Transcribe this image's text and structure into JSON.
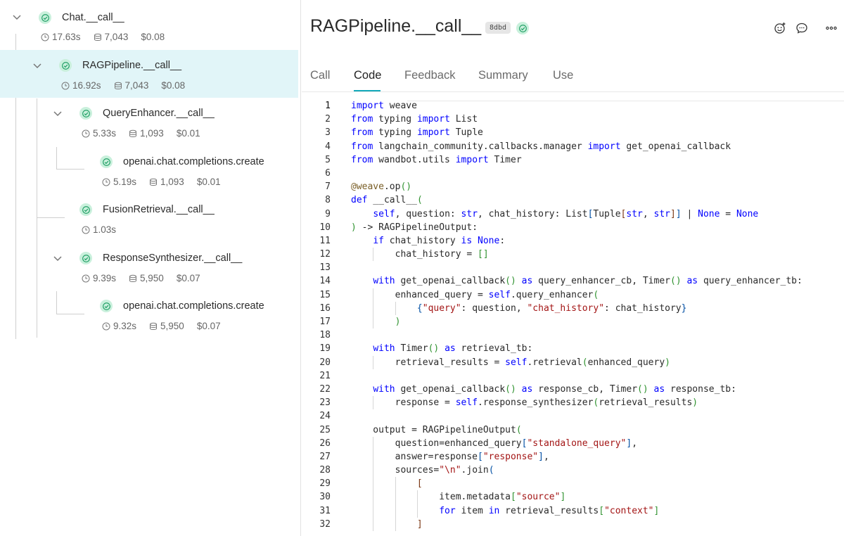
{
  "tree": {
    "nodes": [
      {
        "name": "Chat.__call__",
        "time": "17.63s",
        "tokens": "7,043",
        "cost": "$0.08"
      },
      {
        "name": "RAGPipeline.__call__",
        "time": "16.92s",
        "tokens": "7,043",
        "cost": "$0.08",
        "selected": true
      },
      {
        "name": "QueryEnhancer.__call__",
        "time": "5.33s",
        "tokens": "1,093",
        "cost": "$0.01"
      },
      {
        "name": "openai.chat.completions.create",
        "time": "5.19s",
        "tokens": "1,093",
        "cost": "$0.01"
      },
      {
        "name": "FusionRetrieval.__call__",
        "time": "1.03s"
      },
      {
        "name": "ResponseSynthesizer.__call__",
        "time": "9.39s",
        "tokens": "5,950",
        "cost": "$0.07"
      },
      {
        "name": "openai.chat.completions.create",
        "time": "9.32s",
        "tokens": "5,950",
        "cost": "$0.07"
      }
    ]
  },
  "header": {
    "title": "RAGPipeline.__call__",
    "hash": "8dbd",
    "icons": [
      "add-reaction-icon",
      "comment-icon",
      "more-options-icon"
    ]
  },
  "tabs": [
    "Call",
    "Code",
    "Feedback",
    "Summary",
    "Use"
  ],
  "active_tab": "Code",
  "colors": {
    "accent": "#13a9ba",
    "selected_row": "#e1f5f8",
    "success": "#c9f0dc",
    "keyword": "#0000ff",
    "string": "#a31515"
  },
  "code_lines": [
    "import weave",
    "from typing import List",
    "from typing import Tuple",
    "from langchain_community.callbacks.manager import get_openai_callback",
    "from wandbot.utils import Timer",
    "",
    "@weave.op()",
    "def __call__(",
    "    self, question: str, chat_history: List[Tuple[str, str]] | None = None",
    ") -> RAGPipelineOutput:",
    "    if chat_history is None:",
    "        chat_history = []",
    "",
    "    with get_openai_callback() as query_enhancer_cb, Timer() as query_enhancer_tb:",
    "        enhanced_query = self.query_enhancer(",
    "            {\"query\": question, \"chat_history\": chat_history}",
    "        )",
    "",
    "    with Timer() as retrieval_tb:",
    "        retrieval_results = self.retrieval(enhanced_query)",
    "",
    "    with get_openai_callback() as response_cb, Timer() as response_tb:",
    "        response = self.response_synthesizer(retrieval_results)",
    "",
    "    output = RAGPipelineOutput(",
    "        question=enhanced_query[\"standalone_query\"],",
    "        answer=response[\"response\"],",
    "        sources=\"\\n\".join(",
    "            [",
    "                item.metadata[\"source\"]",
    "                for item in retrieval_results[\"context\"]",
    "            ]"
  ]
}
